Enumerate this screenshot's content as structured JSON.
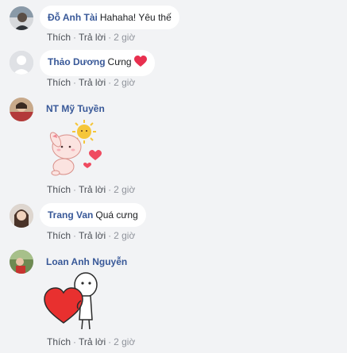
{
  "comments": [
    {
      "name": "Đỗ Anh Tài",
      "text": "Hahaha! Yêu thế",
      "like": "Thích",
      "reply": "Trả lời",
      "time": "2 giờ"
    },
    {
      "name": "Thảo Dương",
      "text": "Cưng",
      "like": "Thích",
      "reply": "Trả lời",
      "time": "2 giờ",
      "emoji_icon": "red-heart-emoji-icon"
    },
    {
      "name": "NT Mỹ Tuyền",
      "sticker": "cute-pink-bunny-sun-hearts-sticker",
      "like": "Thích",
      "reply": "Trả lời",
      "time": "2 giờ"
    },
    {
      "name": "Trang Van",
      "text": "Quá cưng",
      "like": "Thích",
      "reply": "Trả lời",
      "time": "2 giờ"
    },
    {
      "name": "Loan Anh Nguyễn",
      "sticker": "character-holding-big-heart-sticker",
      "like": "Thích",
      "reply": "Trả lời",
      "time": "2 giờ"
    }
  ],
  "separator": "·",
  "colors": {
    "background": "#f2f3f5",
    "bubble": "#ffffff",
    "name": "#385898",
    "meta": "#90949c",
    "heart": "#e8304f"
  }
}
